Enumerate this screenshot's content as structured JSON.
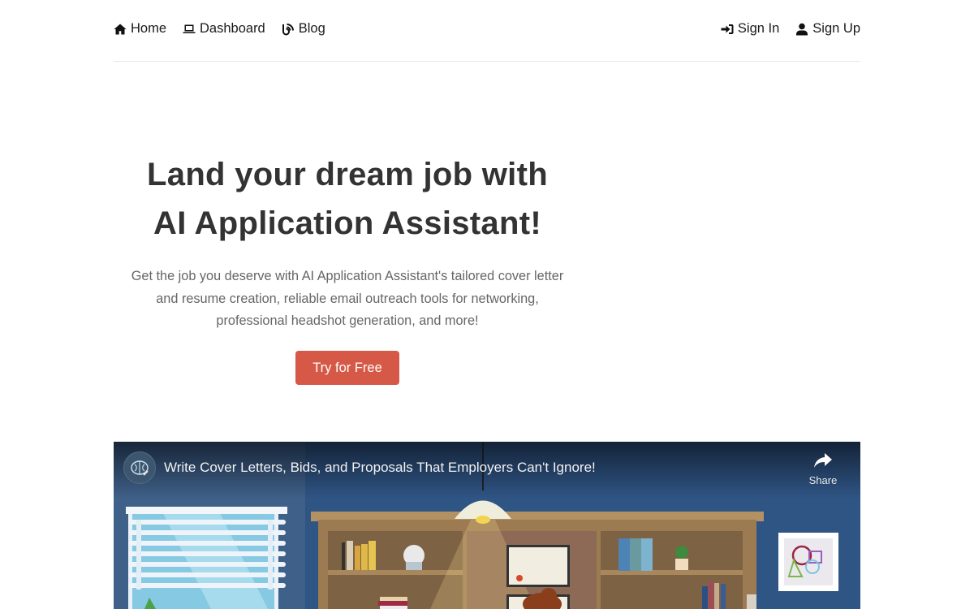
{
  "nav": {
    "left": [
      {
        "label": "Home",
        "icon": "home-icon"
      },
      {
        "label": "Dashboard",
        "icon": "laptop-icon"
      },
      {
        "label": "Blog",
        "icon": "rss-icon"
      }
    ],
    "right": [
      {
        "label": "Sign In",
        "icon": "sign-in-icon"
      },
      {
        "label": "Sign Up",
        "icon": "user-icon"
      }
    ]
  },
  "hero": {
    "title_line1": "Land your dream job with",
    "title_line2": "AI Application Assistant!",
    "description": "Get the job you deserve with AI Application Assistant's tailored cover letter and resume creation, reliable email outreach tools for networking, professional headshot generation, and more!",
    "cta_label": "Try for Free",
    "cta_color": "#d65847"
  },
  "video": {
    "title": "Write Cover Letters, Bids, and Proposals That Employers Can't Ignore!",
    "share_label": "Share",
    "channel_icon": "brain-icon"
  }
}
